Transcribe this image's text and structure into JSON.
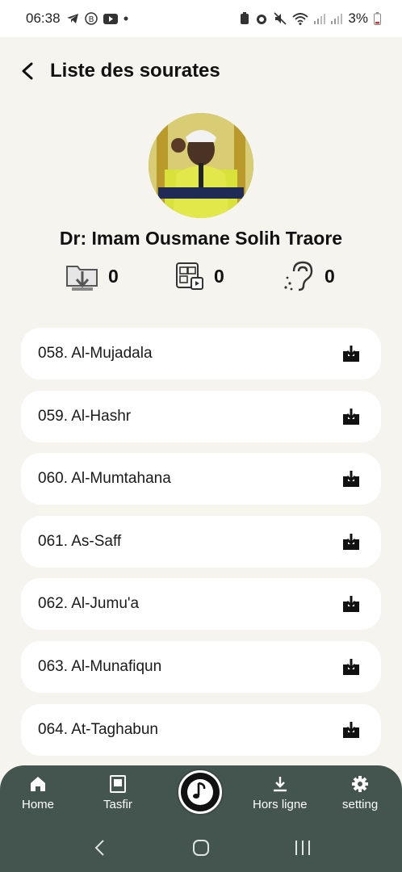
{
  "status_bar": {
    "time": "06:38",
    "battery": "3%",
    "left_icons": [
      "telegram-icon",
      "b-badge-icon",
      "youtube-icon",
      "dot-icon"
    ],
    "right_icons": [
      "battery-saver-icon",
      "alarm-icon",
      "mute-icon",
      "wifi-icon",
      "signal-icon",
      "signal-icon",
      "battery-icon"
    ]
  },
  "header": {
    "title": "Liste des sourates"
  },
  "profile": {
    "name": "Dr: Imam Ousmane Solih Traore",
    "stats": [
      {
        "icon": "download-folder-icon",
        "value": "0"
      },
      {
        "icon": "media-gallery-icon",
        "value": "0"
      },
      {
        "icon": "hearing-icon",
        "value": "0"
      }
    ]
  },
  "suras": [
    {
      "label": "058. Al-Mujadala"
    },
    {
      "label": "059. Al-Hashr"
    },
    {
      "label": "060. Al-Mumtahana"
    },
    {
      "label": "061. As-Saff"
    },
    {
      "label": "062. Al-Jumu'a"
    },
    {
      "label": "063. Al-Munafiqun"
    },
    {
      "label": "064. At-Taghabun"
    }
  ],
  "bottom_nav": {
    "items": [
      {
        "label": "Home",
        "icon": "home-icon"
      },
      {
        "label": "Tasfir",
        "icon": "book-icon"
      },
      {
        "label": "Hors ligne",
        "icon": "download-icon"
      },
      {
        "label": "setting",
        "icon": "gear-icon"
      }
    ],
    "center_icon": "music-note-icon"
  },
  "colors": {
    "background": "#f5f4ee",
    "nav_background": "#44544e",
    "card": "#ffffff"
  }
}
